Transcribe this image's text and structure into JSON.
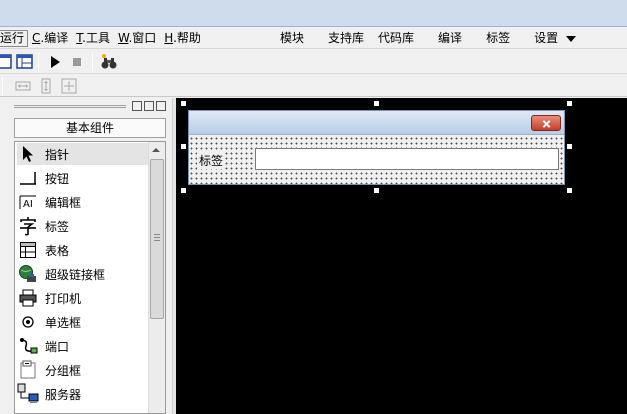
{
  "menubar": {
    "left": [
      {
        "text": "运行"
      },
      {
        "hot": "C",
        "text": ".编译"
      },
      {
        "hot": "T",
        "text": ".工具"
      },
      {
        "hot": "W",
        "text": ".窗口"
      },
      {
        "hot": "H",
        "text": ".帮助"
      }
    ],
    "right": [
      "模块",
      "支持库",
      "代码库",
      "编译",
      "标签",
      "设置"
    ]
  },
  "palette": {
    "group_title": "基本组件",
    "items": [
      {
        "label": "指针",
        "icon": "pointer-arrow-icon"
      },
      {
        "label": "按钮",
        "icon": "button-icon"
      },
      {
        "label": "编辑框",
        "icon": "edit-box-icon"
      },
      {
        "label": "标签",
        "icon": "label-char-icon"
      },
      {
        "label": "表格",
        "icon": "grid-table-icon"
      },
      {
        "label": "超级链接框",
        "icon": "hyperlink-globe-icon"
      },
      {
        "label": "打印机",
        "icon": "printer-icon"
      },
      {
        "label": "单选框",
        "icon": "radio-button-icon"
      },
      {
        "label": "端口",
        "icon": "port-connector-icon"
      },
      {
        "label": "分组框",
        "icon": "group-box-icon"
      },
      {
        "label": "服务器",
        "icon": "server-computer-icon"
      }
    ]
  },
  "form": {
    "label": "标签",
    "input_value": ""
  }
}
